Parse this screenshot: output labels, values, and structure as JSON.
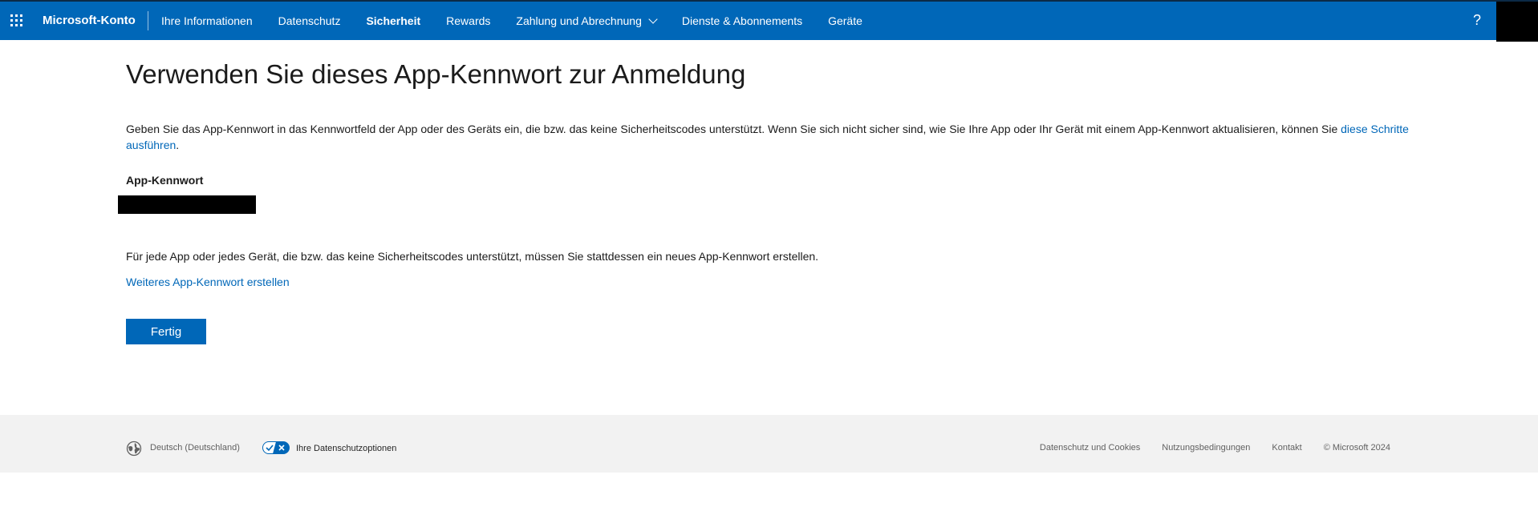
{
  "header": {
    "brand": "Microsoft-Konto",
    "nav": [
      {
        "label": "Ihre Informationen"
      },
      {
        "label": "Datenschutz"
      },
      {
        "label": "Sicherheit"
      },
      {
        "label": "Rewards"
      },
      {
        "label": "Zahlung und Abrechnung"
      },
      {
        "label": "Dienste & Abonnements"
      },
      {
        "label": "Geräte"
      }
    ],
    "help": "?",
    "colors": {
      "bar": "#0067b8",
      "text": "#ffffff"
    }
  },
  "main": {
    "title": "Verwenden Sie dieses App-Kennwort zur Anmeldung",
    "intro_text": "Geben Sie das App-Kennwort in das Kennwortfeld der App oder des Geräts ein, die bzw. das keine Sicherheitscodes unterstützt. Wenn Sie sich nicht sicher sind, wie Sie Ihre App oder Ihr Gerät mit einem App-Kennwort aktualisieren, können Sie ",
    "intro_link": "diese Schritte ausführen",
    "intro_end": ".",
    "password_label": "App-Kennwort",
    "note": "Für jede App oder jedes Gerät, die bzw. das keine Sicherheitscodes unterstützt, müssen Sie stattdessen ein neues App-Kennwort erstellen.",
    "more_link": "Weiteres App-Kennwort erstellen",
    "done_button": "Fertig"
  },
  "footer": {
    "language": "Deutsch (Deutschland)",
    "privacy_options": "Ihre Datenschutzoptionen",
    "links": [
      "Datenschutz und Cookies",
      "Nutzungsbedingungen",
      "Kontakt"
    ],
    "copyright": "© Microsoft 2024"
  }
}
